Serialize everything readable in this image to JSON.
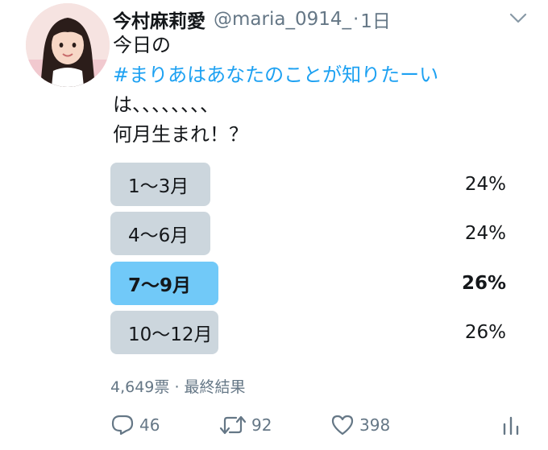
{
  "tweet": {
    "display_name": "今村麻莉愛",
    "handle": "@maria_0914_",
    "separator": "·",
    "time": "1日",
    "text_line1": "今日の",
    "hashtag": "#まりあはあなたのことが知りたーい",
    "text_line3": "は、、、、、、、、",
    "text_line4": "何月生まれ！？"
  },
  "poll": {
    "options": [
      {
        "label": "1〜3月",
        "percent": "24%"
      },
      {
        "label": "4〜6月",
        "percent": "24%"
      },
      {
        "label": "7〜9月",
        "percent": "26%"
      },
      {
        "label": "10〜12月",
        "percent": "26%"
      }
    ],
    "votes": "4,649票",
    "dot": "·",
    "status": "最終結果"
  },
  "actions": {
    "reply_count": "46",
    "retweet_count": "92",
    "like_count": "398"
  },
  "icons": {
    "caret": "chevron-down-icon",
    "reply": "reply-icon",
    "retweet": "retweet-icon",
    "like": "heart-icon",
    "analytics": "analytics-icon"
  },
  "colors": {
    "text": "#14171a",
    "secondary": "#657786",
    "link": "#1da1f2",
    "poll_bar": "#ccd6dd",
    "poll_winner": "#71c9f8"
  }
}
